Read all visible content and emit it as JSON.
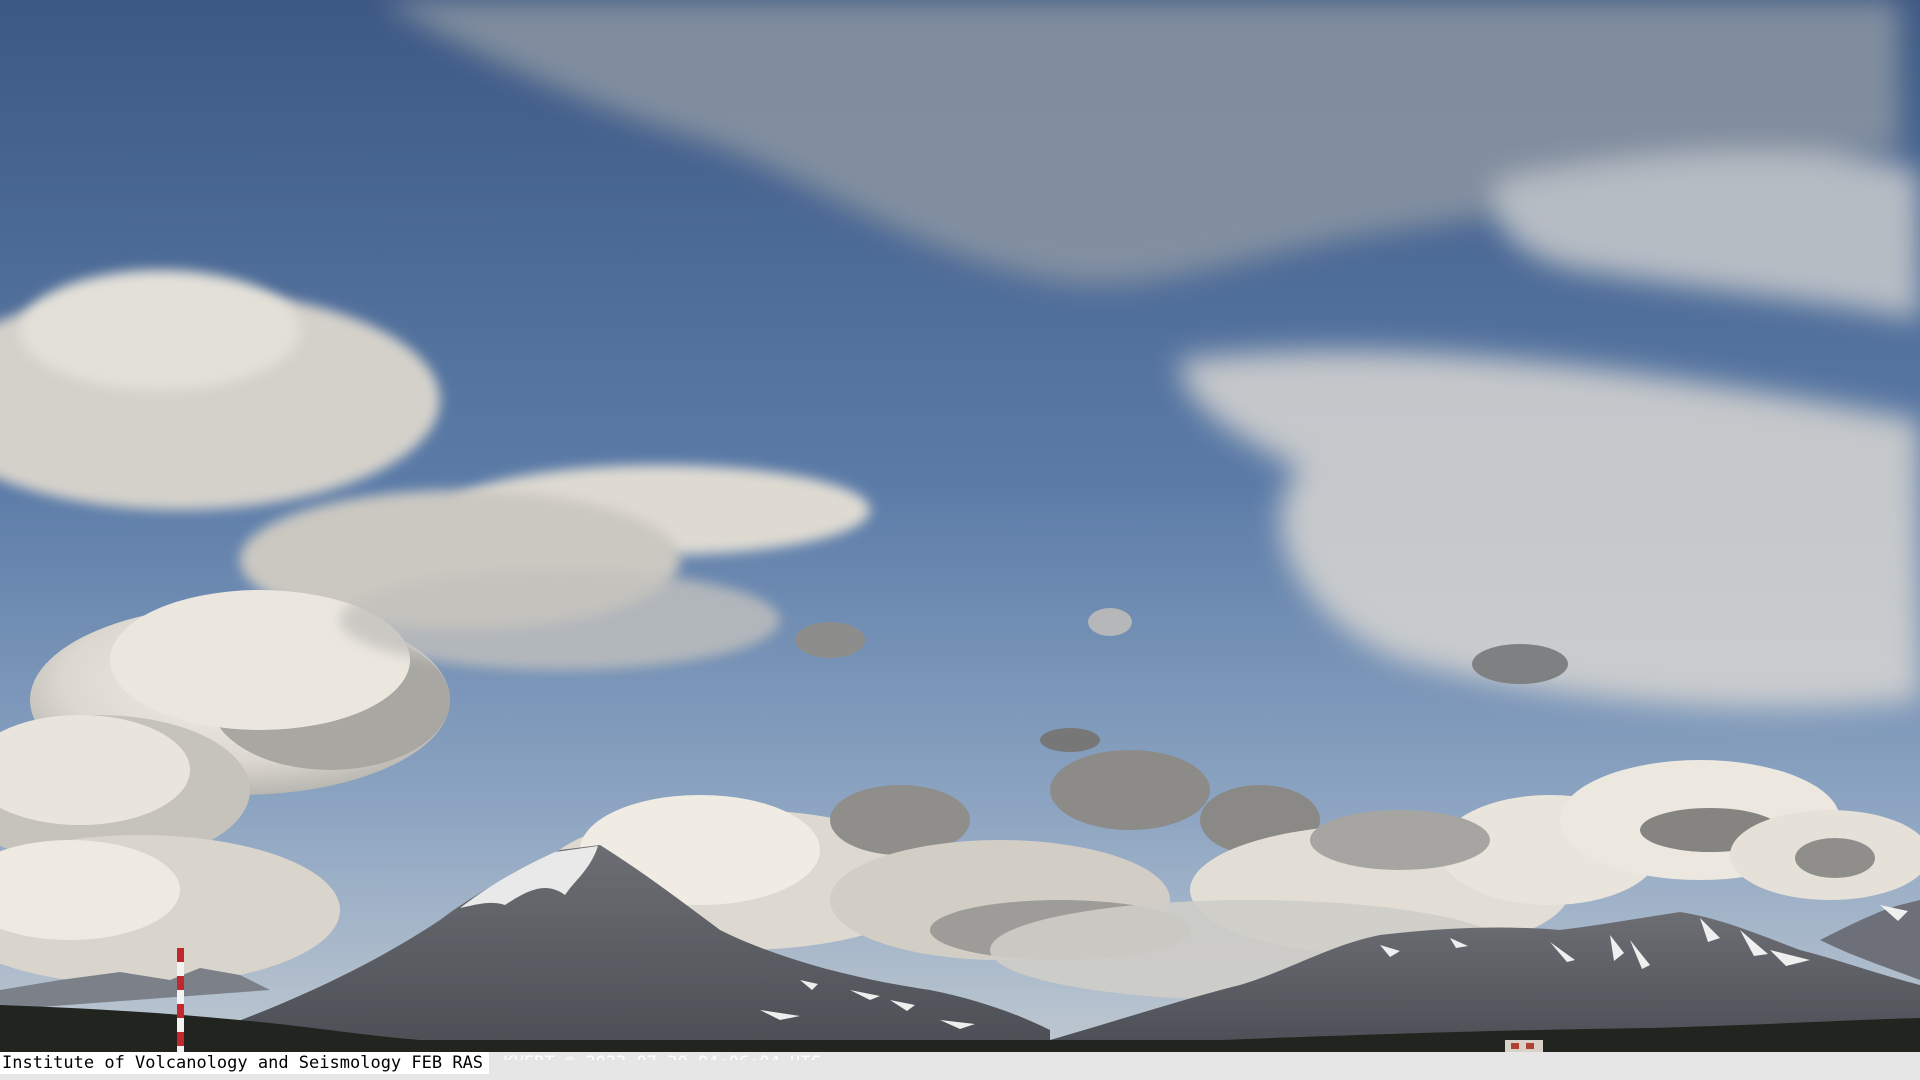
{
  "image": {
    "subject": "webcam-sky-with-volcanoes",
    "colors": {
      "sky_top": "#3f5b86",
      "sky_mid": "#6f8db5",
      "sky_horizon": "#b9c4cf",
      "cloud_light": "#eeeae2",
      "cloud_shadow": "#8f8f8c",
      "mountain": "#5f6168",
      "mountain_far": "#7c818a",
      "snow": "#f2f2f2",
      "ground": "#23251f",
      "mast_red": "#c1272d"
    }
  },
  "caption": {
    "text": "Institute of Volcanology and Seismology FEB RAS",
    "suffix": ". KVERT © 2023-07-30 04:06:04 UTC"
  }
}
